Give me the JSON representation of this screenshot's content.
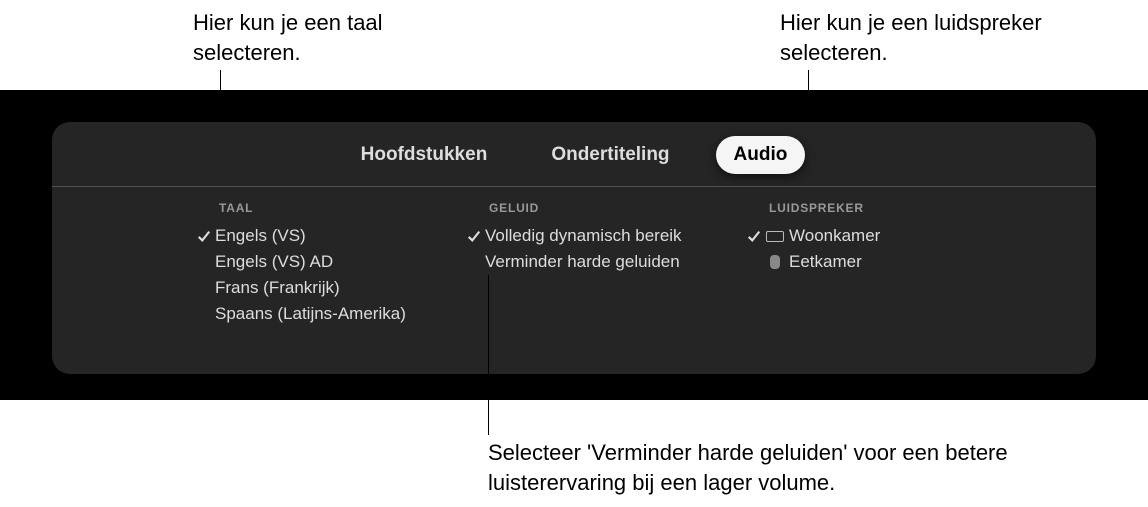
{
  "callouts": {
    "topLeft": "Hier kun je een taal selecteren.",
    "topRight": "Hier kun je een luidspreker selecteren.",
    "bottom": "Selecteer 'Verminder harde geluiden' voor een betere luisterervaring bij een lager volume."
  },
  "tabs": {
    "chapters": "Hoofdstukken",
    "subtitles": "Ondertiteling",
    "audio": "Audio"
  },
  "columns": {
    "taal": {
      "header": "TAAL",
      "items": [
        {
          "label": "Engels (VS)",
          "selected": true
        },
        {
          "label": "Engels (VS) AD",
          "selected": false
        },
        {
          "label": "Frans (Frankrijk)",
          "selected": false
        },
        {
          "label": "Spaans (Latijns-Amerika)",
          "selected": false
        }
      ]
    },
    "geluid": {
      "header": "GELUID",
      "items": [
        {
          "label": "Volledig dynamisch bereik",
          "selected": true
        },
        {
          "label": "Verminder harde geluiden",
          "selected": false
        }
      ]
    },
    "speaker": {
      "header": "LUIDSPREKER",
      "items": [
        {
          "label": "Woonkamer",
          "selected": true,
          "icon": "tv"
        },
        {
          "label": "Eetkamer",
          "selected": false,
          "icon": "pod"
        }
      ]
    }
  }
}
